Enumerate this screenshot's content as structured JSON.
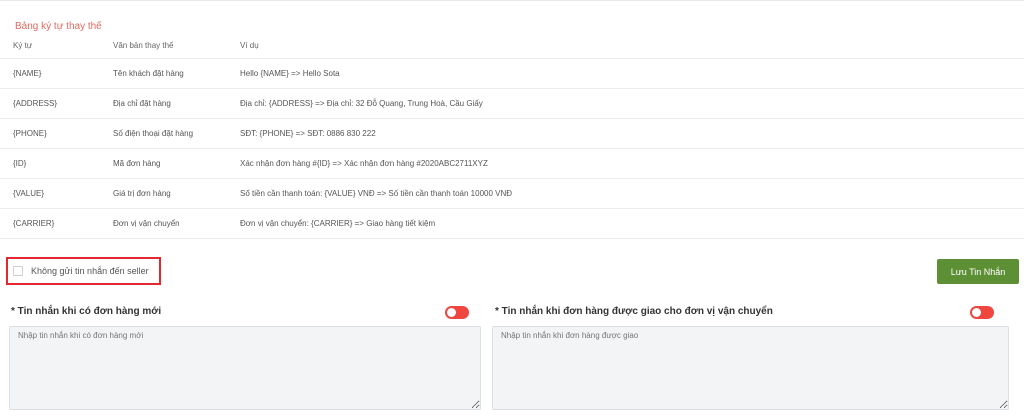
{
  "section_title": "Bảng ký tự thay thế",
  "table": {
    "headers": [
      "Ký tự",
      "Văn bản thay thế",
      "Ví dụ"
    ],
    "rows": [
      [
        "{NAME}",
        "Tên khách đặt hàng",
        "Hello {NAME} => Hello Sota"
      ],
      [
        "{ADDRESS}",
        "Địa chỉ đặt hàng",
        "Địa chỉ: {ADDRESS} => Địa chỉ: 32 Đỗ Quang, Trung Hoà, Cầu Giấy"
      ],
      [
        "{PHONE}",
        "Số điện thoại đặt hàng",
        "SĐT: {PHONE} => SĐT: 0886 830 222"
      ],
      [
        "{ID}",
        "Mã đơn hàng",
        "Xác nhận đơn hàng #{ID} => Xác nhận đơn hàng #2020ABC2711XYZ"
      ],
      [
        "{VALUE}",
        "Giá trị đơn hàng",
        "Số tiền cần thanh toán: {VALUE} VNĐ => Số tiền cần thanh toán 10000 VNĐ"
      ],
      [
        "{CARRIER}",
        "Đơn vị vận chuyển",
        "Đơn vị vận chuyển: {CARRIER} => Giao hàng tiết kiệm"
      ]
    ]
  },
  "checkbox": {
    "label": "Không gửi tin nhắn đến seller",
    "checked": false
  },
  "save_button": {
    "label": "Lưu Tin Nhắn"
  },
  "panels": [
    {
      "label": "* Tin nhắn khi có đơn hàng mới",
      "toggle_on": true,
      "placeholder": "Nhập tin nhắn khi có đơn hàng mới"
    },
    {
      "label": "* Tin nhắn khi đơn hàng được giao cho đơn vị vận chuyển",
      "toggle_on": true,
      "placeholder": "Nhập tin nhắn khi đơn hàng được giao"
    }
  ],
  "colors": {
    "accent_green": "#5d8f35",
    "toggle_red": "#ef4640",
    "title_red": "#e06a5e",
    "highlight_red": "#e3282f"
  }
}
